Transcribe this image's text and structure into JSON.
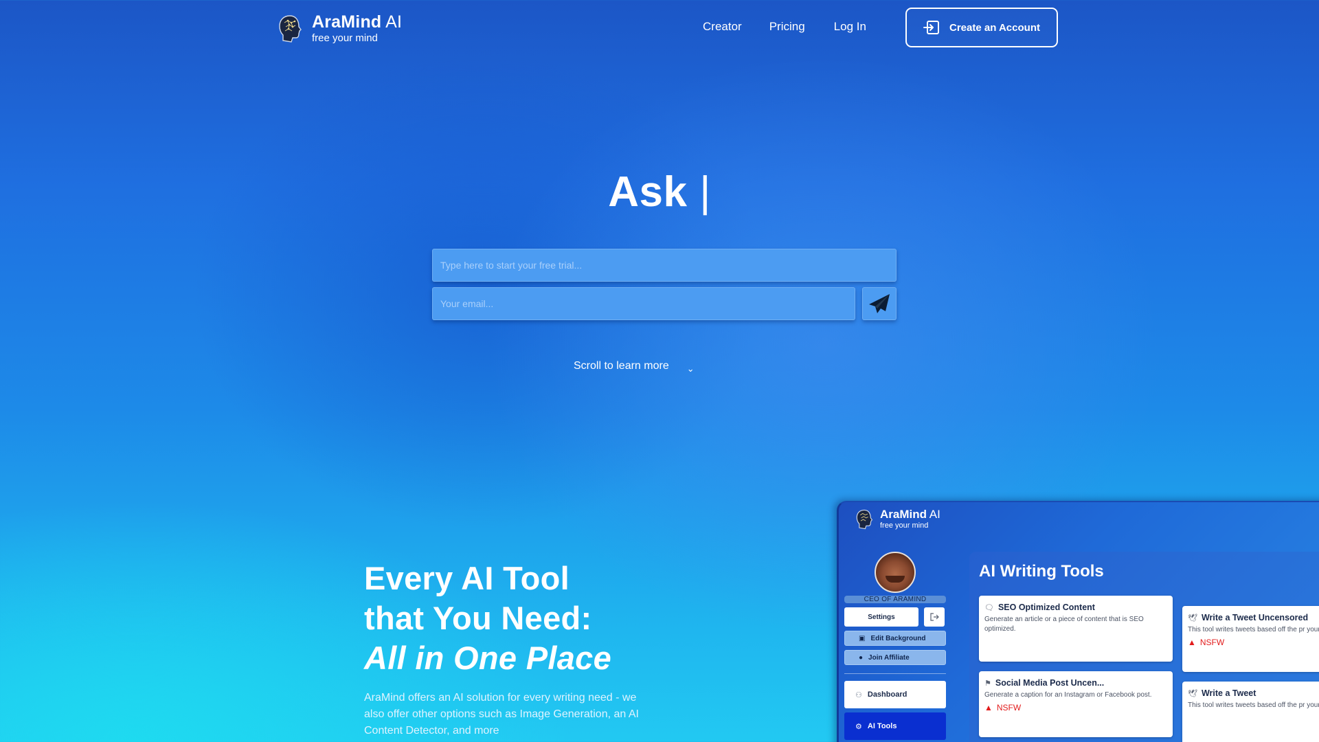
{
  "nav": {
    "brand_name": "AraMind",
    "brand_ai": " AI",
    "tagline": "free your mind",
    "links": [
      "Creator",
      "Pricing",
      "Log In"
    ],
    "cta_label": "Create an Account"
  },
  "hero": {
    "title": "Ask",
    "cursor": "|",
    "prompt_placeholder": "Type here to start your free trial...",
    "email_placeholder": "Your email...",
    "scroll_hint": "Scroll to learn more",
    "scroll_chevron": "⌄"
  },
  "feature": {
    "heading_line1": "Every AI Tool",
    "heading_line2": "that You Need:",
    "heading_line3": "All in One Place",
    "body": "AraMind offers an AI solution for every writing need - we also offer other options such as Image Generation, an AI Content Detector, and more"
  },
  "preview": {
    "brand_name": "AraMind",
    "brand_ai": " AI",
    "tagline": "free your mind",
    "role": "CEO OF ARAMIND",
    "settings_label": "Settings",
    "edit_bg_label": "Edit Background",
    "affiliate_label": "Join Affiliate",
    "dashboard_label": "Dashboard",
    "ai_tools_label": "AI Tools",
    "section_title": "AI Writing Tools",
    "tools": [
      {
        "title": "SEO Optimized Content",
        "desc": "Generate an article or a piece of content that is SEO optimized.",
        "badge": ""
      },
      {
        "title": "Write a Tweet Uncensored",
        "desc": "This tool writes tweets based off the pr your past tweets.",
        "badge": "NSFW"
      },
      {
        "title": "Social Media Post Uncen...",
        "desc": "Generate a caption for an Instagram or Facebook post.",
        "badge": "NSFW"
      },
      {
        "title": "Write a Tweet",
        "desc": "This tool writes tweets based off the pr your past tweets.",
        "badge": ""
      }
    ]
  },
  "icons": {
    "logo": "brain-head-icon",
    "cta": "sign-in-icon",
    "send": "paper-plane-icon",
    "chevron": "chevron-down-icon"
  },
  "colors": {
    "accent_active": "#0a2fd0",
    "nsfw_red": "#e21b1b",
    "field_bg": "#4c9cf2"
  }
}
